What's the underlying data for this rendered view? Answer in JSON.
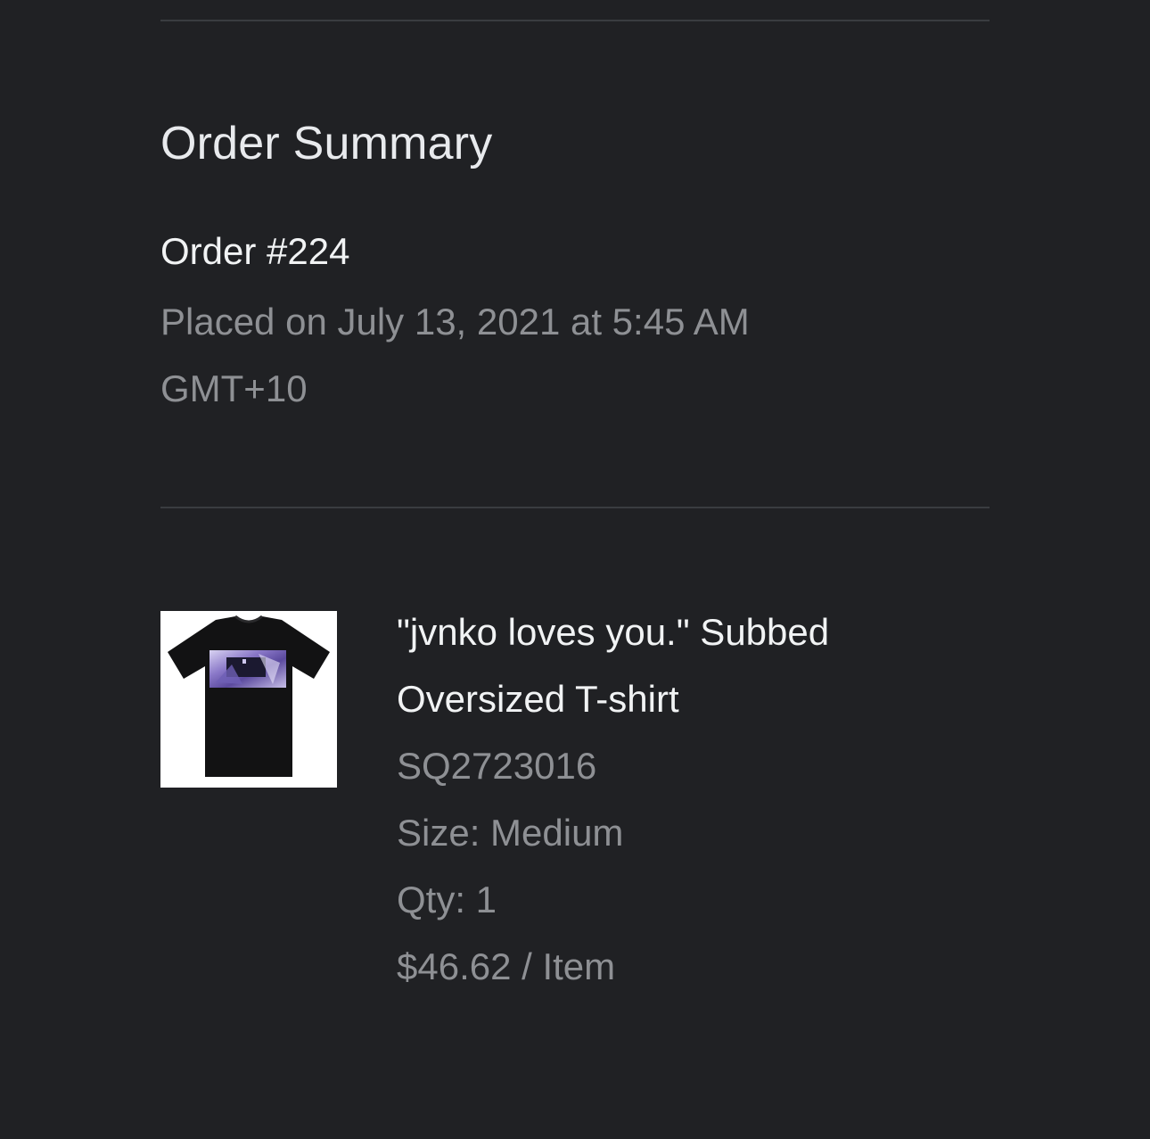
{
  "order_summary": {
    "title": "Order Summary",
    "order_number": "Order #224",
    "placed_on": "Placed on July 13, 2021 at 5:45 AM GMT+10"
  },
  "item": {
    "image": "black-t-shirt-with-purple-print",
    "title": "\"jvnko loves you.\" Subbed Oversized T-shirt",
    "sku": "SQ2723016",
    "size": "Size: Medium",
    "qty": "Qty: 1",
    "price": "$46.62 / Item"
  },
  "colors": {
    "background": "#202124",
    "primary_text": "#f1f3f4",
    "secondary_text": "#8e9094",
    "divider": "#3a3c40"
  }
}
